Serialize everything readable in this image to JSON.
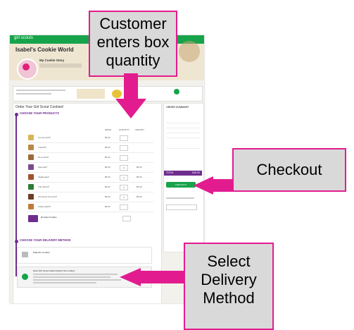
{
  "callouts": {
    "quantity": [
      "Customer",
      "enters box",
      "quantity"
    ],
    "checkout": "Checkout",
    "delivery": [
      "Select",
      "Delivery",
      "Method"
    ]
  },
  "screenshot": {
    "brand": "girl scouts",
    "page_title": "Isabel's Cookie World",
    "story_title": "My Cookie Story",
    "order_heading": "Order Your Girl Scout Cookies!",
    "step1": "CHOOSE YOUR PRODUCTS",
    "step2": "CHOOSE YOUR DELIVERY METHOD",
    "summary_title": "ORDER SUMMARY",
    "total_label": "TOTAL",
    "total_value": "$16.00",
    "checkout_label": "CHECKOUT",
    "ship_label": "Ship the cookies",
    "deliver_label": "Have Girl Scout Isabel deliver the cookies",
    "col_price": "PRICE",
    "col_qty": "QUANTITY",
    "col_amount": "AMOUNT",
    "donate_label": "Donate Cookies",
    "products": [
      {
        "name": "Lemon-Ups®",
        "price": "$5.00",
        "qty": "",
        "amount": ""
      },
      {
        "name": "Trefoils®",
        "price": "$5.00",
        "qty": "",
        "amount": ""
      },
      {
        "name": "Do-si-dos®",
        "price": "$5.00",
        "qty": "",
        "amount": ""
      },
      {
        "name": "Samoas®",
        "price": "$5.00",
        "qty": "1",
        "amount": "$5.00"
      },
      {
        "name": "Tagalongs®",
        "price": "$5.00",
        "qty": "1",
        "amount": "$5.00"
      },
      {
        "name": "Thin Mints®",
        "price": "$5.00",
        "qty": "1",
        "amount": "$5.00"
      },
      {
        "name": "Girl Scout S'mores®",
        "price": "$5.00",
        "qty": "1",
        "amount": "$5.00"
      },
      {
        "name": "Toffee-tastic®",
        "price": "$5.00",
        "qty": "",
        "amount": ""
      }
    ]
  }
}
